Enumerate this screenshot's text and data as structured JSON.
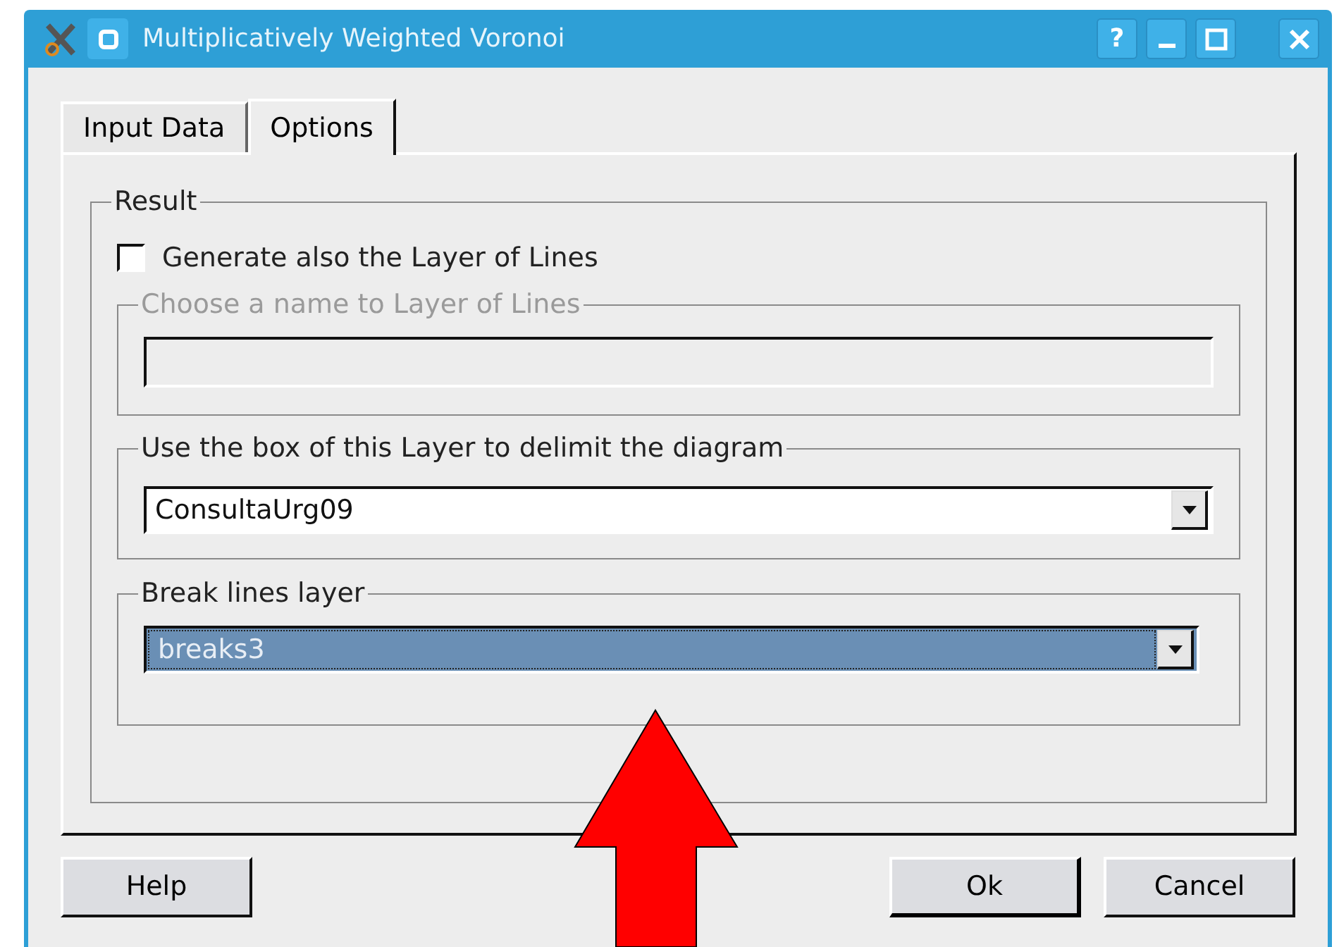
{
  "window": {
    "title": "Multiplicatively Weighted Voronoi",
    "controls": [
      {
        "kind": "help",
        "label": "?"
      },
      {
        "kind": "minimize"
      },
      {
        "kind": "maximize"
      },
      {
        "kind": "close"
      }
    ]
  },
  "tabs": [
    {
      "label": "Input Data",
      "selected": false
    },
    {
      "label": "Options",
      "selected": true
    }
  ],
  "result": {
    "label": "Result",
    "checkbox": {
      "label": "Generate also the Layer of Lines",
      "checked": false
    },
    "name_group": {
      "label": "Choose a name to Layer of Lines",
      "disabled": true
    },
    "box_group": {
      "label": "Use the box of this Layer to delimit the diagram",
      "value": "ConsultaUrg09",
      "selected": false
    },
    "break_group": {
      "label": "Break lines layer",
      "value": "breaks3",
      "selected": true
    }
  },
  "buttons": [
    {
      "label": "Help",
      "default": false
    },
    {
      "label": "Ok",
      "default": true
    },
    {
      "label": "Cancel",
      "default": false
    }
  ]
}
